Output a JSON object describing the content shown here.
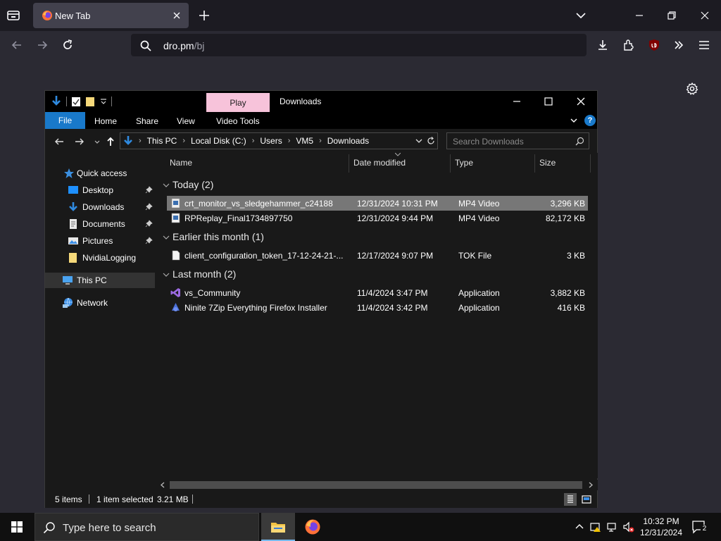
{
  "browser": {
    "tab": {
      "title": "New Tab"
    },
    "url": {
      "host": "dro.pm",
      "path": "/bj"
    }
  },
  "explorer": {
    "title": "Downloads",
    "contextual_tab": "Play",
    "ribbon": {
      "file": "File",
      "tabs": [
        "Home",
        "Share",
        "View",
        "Video Tools"
      ]
    },
    "breadcrumbs": [
      "This PC",
      "Local Disk (C:)",
      "Users",
      "VM5",
      "Downloads"
    ],
    "search_placeholder": "Search Downloads",
    "nav": {
      "quick_access": "Quick access",
      "pinned": [
        "Desktop",
        "Downloads",
        "Documents",
        "Pictures"
      ],
      "other": "NvidiaLogging",
      "this_pc": "This PC",
      "network": "Network"
    },
    "columns": [
      "Name",
      "Date modified",
      "Type",
      "Size"
    ],
    "groups": [
      {
        "label": "Today (2)",
        "files": [
          {
            "name": "crt_monitor_vs_sledgehammer_c24188",
            "date": "12/31/2024 10:31 PM",
            "type": "MP4 Video",
            "size": "3,296 KB",
            "icon": "video-file-icon",
            "selected": true
          },
          {
            "name": "RPReplay_Final1734897750",
            "date": "12/31/2024 9:44 PM",
            "type": "MP4 Video",
            "size": "82,172 KB",
            "icon": "video-file-icon"
          }
        ]
      },
      {
        "label": "Earlier this month (1)",
        "files": [
          {
            "name": "client_configuration_token_17-12-24-21-...",
            "date": "12/17/2024 9:07 PM",
            "type": "TOK File",
            "size": "3 KB",
            "icon": "document-file-icon"
          }
        ]
      },
      {
        "label": "Last month (2)",
        "files": [
          {
            "name": "vs_Community",
            "date": "11/4/2024 3:47 PM",
            "type": "Application",
            "size": "3,882 KB",
            "icon": "visual-studio-icon"
          },
          {
            "name": "Ninite 7Zip Everything Firefox Installer",
            "date": "11/4/2024 3:42 PM",
            "type": "Application",
            "size": "416 KB",
            "icon": "ninite-icon"
          }
        ]
      }
    ],
    "status": {
      "items": "5 items",
      "selected": "1 item selected",
      "size": "3.21 MB"
    }
  },
  "taskbar": {
    "search_placeholder": "Type here to search",
    "time": "10:32 PM",
    "date": "12/31/2024",
    "notifications": "2"
  },
  "colors": {
    "accent": "#1979ca",
    "play_tab": "#f7c3da",
    "selection": "#777777"
  }
}
